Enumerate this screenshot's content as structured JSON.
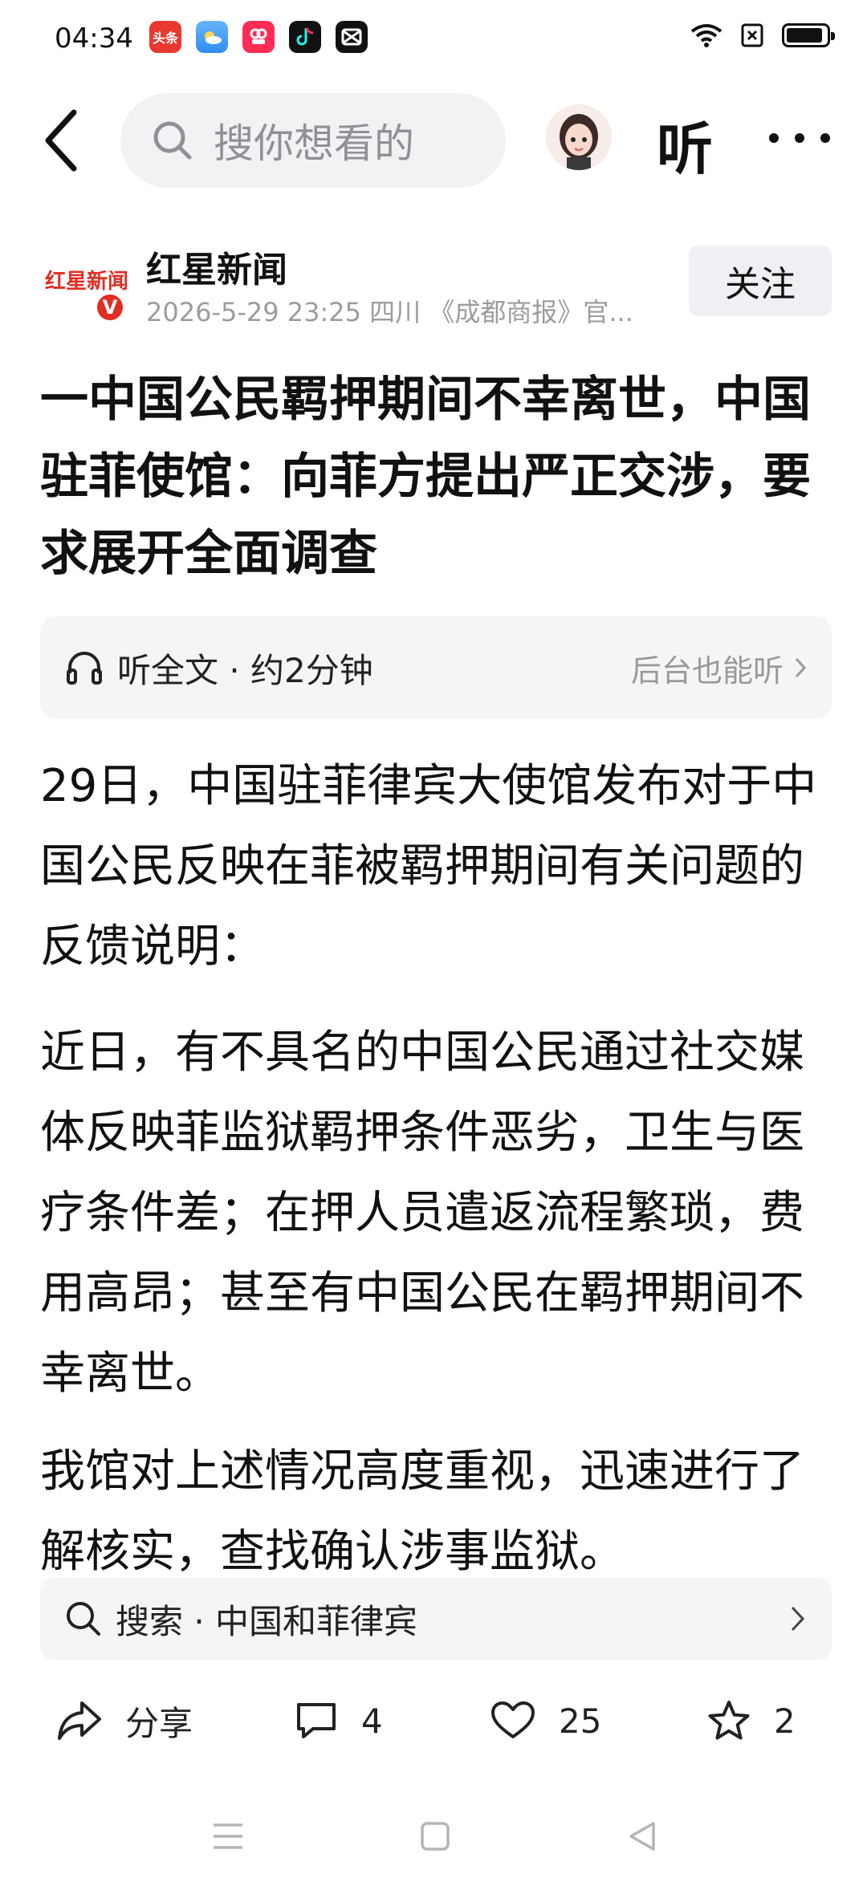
{
  "status_bar": {
    "time": "04:34",
    "app_icons": [
      "toutiao-icon",
      "weather-icon",
      "dianshi-icon",
      "tiktok-icon",
      "capcut-icon"
    ],
    "toutiao_label": "头条"
  },
  "nav": {
    "search_placeholder": "搜你想看的",
    "listen_label": "听"
  },
  "author": {
    "name": "红星新闻",
    "logo_text": "红星新闻",
    "verified_mark": "V",
    "meta": "2026-5-29  23:25  四川  《成都商报》官...",
    "follow_label": "关注"
  },
  "article": {
    "headline": "一中国公民羁押期间不幸离世，中国驻菲使馆：向菲方提出严正交涉，要求展开全面调查",
    "listen_full": "听全文 · 约2分钟",
    "listen_background": "后台也能听",
    "paragraphs": [
      "29日，中国驻菲律宾大使馆发布对于中国公民反映在菲被羁押期间有关问题的反馈说明：",
      "近日，有不具名的中国公民通过社交媒体反映菲监狱羁押条件恶劣，卫生与医疗条件差；在押人员遣返流程繁琐，费用高昂；甚至有中国公民在羁押期间不幸离世。",
      "我馆对上述情况高度重视，迅速进行了解核实，查找确认涉事监狱。"
    ]
  },
  "suggest": {
    "label": "搜索 · 中国和菲律宾"
  },
  "actions": {
    "share_label": "分享",
    "comments": "4",
    "likes": "25",
    "favorites": "2"
  },
  "colors": {
    "accent_red": "#e02e24",
    "muted": "#9a9ca1",
    "panel": "#f4f5f7"
  }
}
